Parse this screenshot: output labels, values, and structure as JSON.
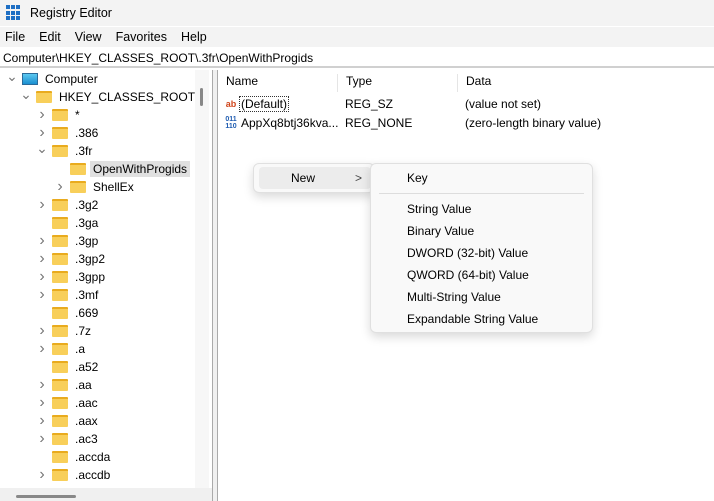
{
  "title": "Registry Editor",
  "menu": [
    "File",
    "Edit",
    "View",
    "Favorites",
    "Help"
  ],
  "address": "Computer\\HKEY_CLASSES_ROOT\\.3fr\\OpenWithProgids",
  "tree": [
    {
      "label": "Computer",
      "level": 0,
      "chev": "v",
      "icon": "computer"
    },
    {
      "label": "HKEY_CLASSES_ROOT",
      "level": 1,
      "chev": "v"
    },
    {
      "label": "*",
      "level": 2,
      "chev": ">"
    },
    {
      "label": ".386",
      "level": 2,
      "chev": ">"
    },
    {
      "label": ".3fr",
      "level": 2,
      "chev": "v"
    },
    {
      "label": "OpenWithProgids",
      "level": 3,
      "chev": "",
      "selected": true
    },
    {
      "label": "ShellEx",
      "level": 3,
      "chev": ">"
    },
    {
      "label": ".3g2",
      "level": 2,
      "chev": ">"
    },
    {
      "label": ".3ga",
      "level": 2,
      "chev": ""
    },
    {
      "label": ".3gp",
      "level": 2,
      "chev": ">"
    },
    {
      "label": ".3gp2",
      "level": 2,
      "chev": ">"
    },
    {
      "label": ".3gpp",
      "level": 2,
      "chev": ">"
    },
    {
      "label": ".3mf",
      "level": 2,
      "chev": ">"
    },
    {
      "label": ".669",
      "level": 2,
      "chev": ""
    },
    {
      "label": ".7z",
      "level": 2,
      "chev": ">"
    },
    {
      "label": ".a",
      "level": 2,
      "chev": ">"
    },
    {
      "label": ".a52",
      "level": 2,
      "chev": ""
    },
    {
      "label": ".aa",
      "level": 2,
      "chev": ">"
    },
    {
      "label": ".aac",
      "level": 2,
      "chev": ">"
    },
    {
      "label": ".aax",
      "level": 2,
      "chev": ">"
    },
    {
      "label": ".ac3",
      "level": 2,
      "chev": ">"
    },
    {
      "label": ".accda",
      "level": 2,
      "chev": ""
    },
    {
      "label": ".accdb",
      "level": 2,
      "chev": ">"
    }
  ],
  "columns": [
    "Name",
    "Type",
    "Data"
  ],
  "values": [
    {
      "icon": "string-value-icon",
      "name": "(Default)",
      "type": "REG_SZ",
      "data": "(value not set)"
    },
    {
      "icon": "binary-value-icon",
      "name": "AppXq8btj36kva...",
      "type": "REG_NONE",
      "data": "(zero-length binary value)"
    }
  ],
  "context_menu": {
    "new_label": "New",
    "arrow": ">"
  },
  "submenu": {
    "key": "Key",
    "items": [
      "String Value",
      "Binary Value",
      "DWORD (32-bit) Value",
      "QWORD (64-bit) Value",
      "Multi-String Value",
      "Expandable String Value"
    ]
  }
}
